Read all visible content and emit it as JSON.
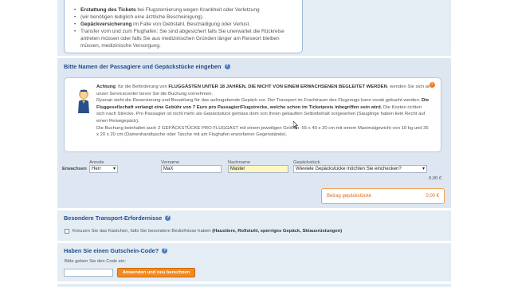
{
  "insurance": {
    "bullets": [
      {
        "bold": "Erstattung des Tickets",
        "text": " bei Flugstornierung wegen Krankheit oder Verletzung"
      },
      {
        "bold": "",
        "text": "(wir benötigen lediglich eine ärztliche Bescheinigung)."
      },
      {
        "bold": "Gepäckversicherung",
        "text": " im Falle von Diebstahl, Beschädigung oder Verlust."
      },
      {
        "bold": "",
        "text": "Transfer vom und zum Flughafen: Sie sind abgesichert falls Sie unerwartet die Rückreise antreten müssen oder falls Sie aus medizinischen Gründen länger am Reiseort bleiben müssen, medizinische Versorgung."
      }
    ]
  },
  "passengers": {
    "title": "Bitte Namen der Passagiere und Gepäckstücke eingeben",
    "notice": {
      "p1_prefix": "Achtung",
      "p1_text": ": für die Beförderung von ",
      "p1_bold": "FLUGGÄSTEN UNTER 18 JAHREN, DIE NICHT VON EINEM ERWACHSENEN BEGLEITET WERDEN",
      "p1_suffix": ", wenden Sie sich an unser Servicecenter bevor Sie die Buchung vornehmen.",
      "p2_text": "Ryanair sieht die Reservierung und Bezahlung für das aufzugebende Gepäck vor. Der Transport im Frachtraum des Flugzeugs kann vorab gebucht werden. ",
      "p2_bold": "Die Fluggesellschaft verlangt eine Gebühr von 7 Euro pro Passagier/Flugstrecke, welche schon im Ticketpreis inbegriffen sein wird.",
      "p2_suffix": " Die Kosten richten sich nach Strecke. Pro Passagier ist nicht mehr als Gepäckstück gemäss dem von Ihnen gekauften Selbstbehalt vorgesehen (Säuglinge haben kein Recht auf einen Reisegepäck).",
      "p3_text": "Die Buchung beinhaltet auch 2 GEPÄCKSTÜCKE PRO FLUGGAST mit einem jeweiligen Größen: 55 x 40 x 20 cm mit einem Maximalgewicht von 10 kg und 35 x 20 x 20 cm (Damenhandtasche oder Tasche mit am Flughafen erworbener Gegenstände)."
    },
    "form": {
      "row_label": "Erwachsen",
      "anrede_label": "Anrede",
      "anrede_value": "Herr",
      "vorname_label": "Vorname",
      "vorname_value": "MaX",
      "nachname_label": "Nachname",
      "nachname_value": "Master",
      "gepaeck_label": "Gepäckstück",
      "gepaeck_value": "Wieviele Gepäckstücke möchten Sie einchecken?",
      "row_price": "0,00 €"
    },
    "total": {
      "label": "Betrag gepäckstücke",
      "value": "0,00 €"
    }
  },
  "transport": {
    "title": "Besondere Transport-Erfordernisse",
    "checkbox_text": "Kreuzen Sie das Kästchen, falls Sie besondere Bedürfnisse haben ",
    "checkbox_bold": "(Haustiere, Rollstuhl, sperriges Gepäck, Skiausrüstungen)"
  },
  "voucher": {
    "title": "Haben Sie einen Gutschein-Code?",
    "input_label": "Bitte geben Sie den Code ein:",
    "button_label": "Anwenden und neu berechnen"
  }
}
